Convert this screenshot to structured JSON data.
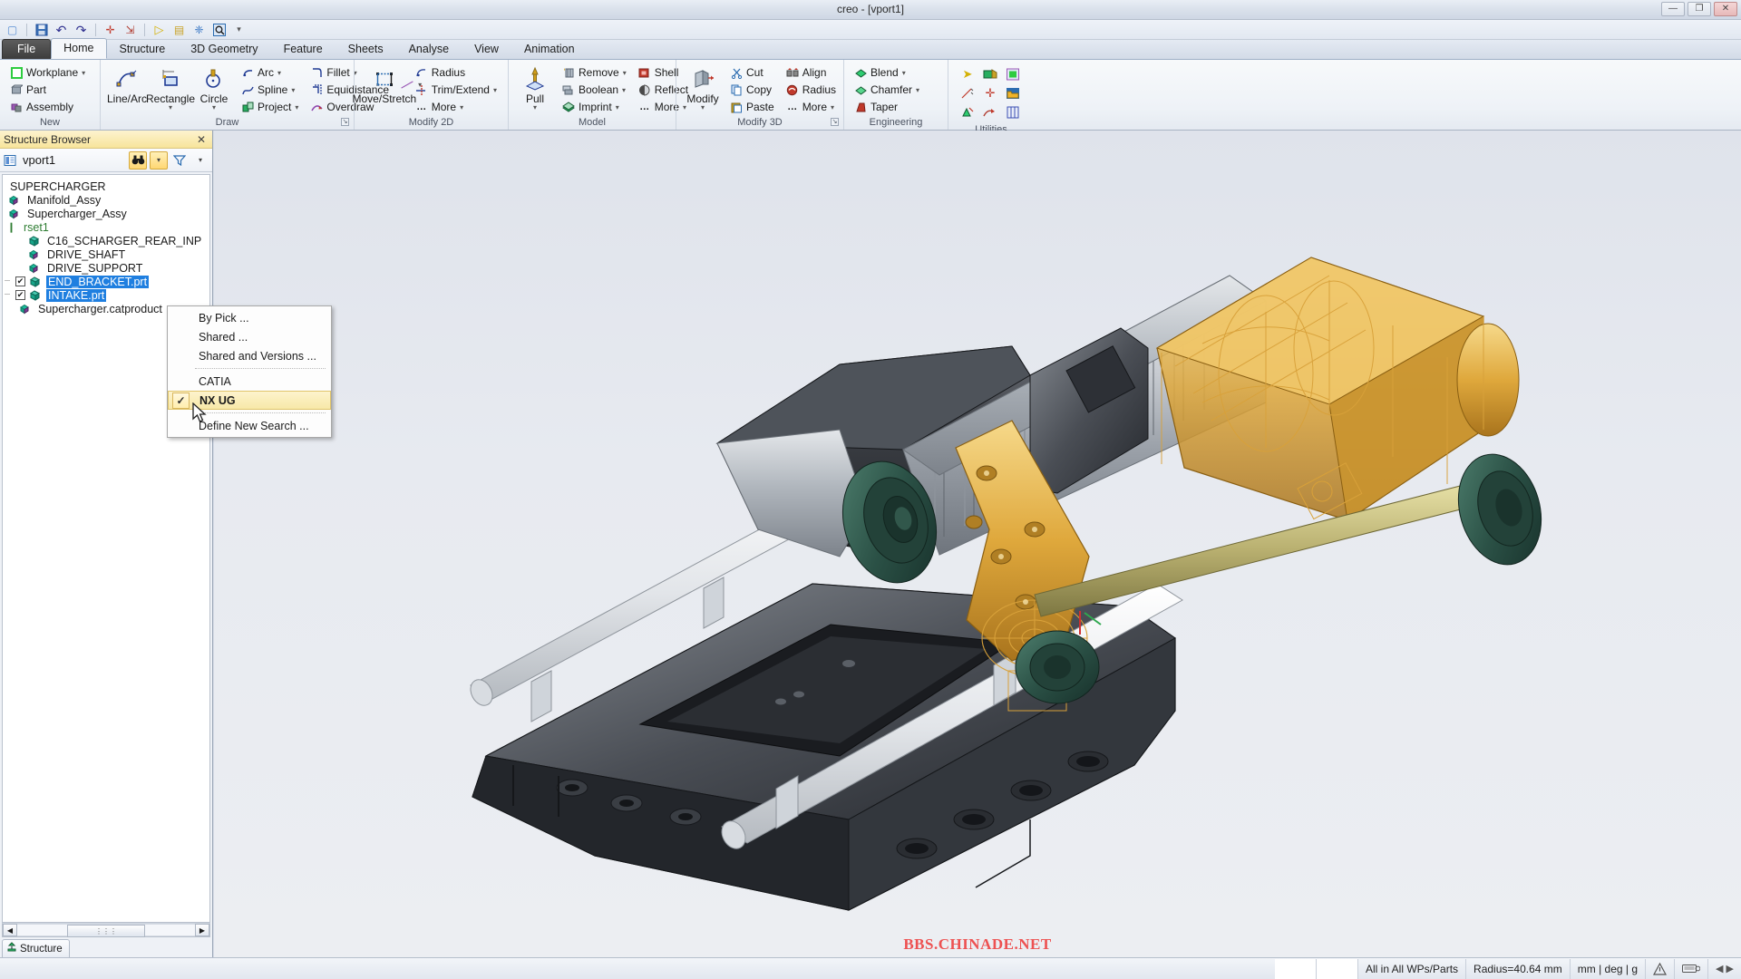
{
  "window": {
    "title": "creo - [vport1]",
    "buttons": [
      {
        "name": "minimize",
        "glyph": "—"
      },
      {
        "name": "restore",
        "glyph": "❐"
      },
      {
        "name": "close",
        "glyph": "✕"
      }
    ]
  },
  "quick_access": {
    "items": [
      {
        "name": "new-document-icon",
        "glyph": "▢",
        "color": "#5b8fd4"
      },
      {
        "name": "save-icon",
        "glyph": "💾",
        "color": "#2b5fa8"
      },
      {
        "name": "undo-icon",
        "glyph": "↶",
        "color": "#2f2f8f"
      },
      {
        "name": "redo-icon",
        "glyph": "↷",
        "color": "#2f2f8f"
      },
      {
        "name": "measure-icon",
        "glyph": "✛",
        "color": "#c0392b"
      },
      {
        "name": "export-icon",
        "glyph": "⇲",
        "color": "#b03a2e"
      },
      {
        "name": "play-icon",
        "glyph": "▷",
        "color": "#d4b106"
      },
      {
        "name": "list-play-icon",
        "glyph": "▤",
        "color": "#c9a227"
      },
      {
        "name": "snap-icon",
        "glyph": "❈",
        "color": "#3574c4"
      },
      {
        "name": "zoom-window-icon",
        "glyph": "🔍",
        "color": "#2b6cb0"
      },
      {
        "name": "customize-qat-icon",
        "glyph": "⋮",
        "color": "#555"
      }
    ]
  },
  "tabs": [
    {
      "name": "file",
      "label": "File"
    },
    {
      "name": "home",
      "label": "Home"
    },
    {
      "name": "structure",
      "label": "Structure"
    },
    {
      "name": "3d-geometry",
      "label": "3D Geometry"
    },
    {
      "name": "feature",
      "label": "Feature"
    },
    {
      "name": "sheets",
      "label": "Sheets"
    },
    {
      "name": "analyse",
      "label": "Analyse"
    },
    {
      "name": "view",
      "label": "View"
    },
    {
      "name": "animation",
      "label": "Animation"
    }
  ],
  "active_tab": "Home",
  "ribbon": {
    "groups": [
      {
        "name": "new",
        "title": "New",
        "dialog_launcher": false,
        "minis": [
          {
            "label": "Workplane",
            "icon": "workplane-icon",
            "glyph": "▢",
            "color": "#2ecc40",
            "caret": true
          },
          {
            "label": "Part",
            "icon": "part-icon",
            "glyph": "▤",
            "color": "#7f8c8d",
            "caret": false
          },
          {
            "label": "Assembly",
            "icon": "assembly-icon",
            "glyph": "▥",
            "color": "#8e44ad",
            "caret": false
          }
        ]
      },
      {
        "name": "draw",
        "title": "Draw",
        "dialog_launcher": true,
        "bigs": [
          {
            "label": "Line/Arc",
            "icon": "line-arc-icon",
            "glyph": "⌒",
            "color": "#1f3a93",
            "caret": false
          },
          {
            "label": "Rectangle",
            "icon": "rectangle-icon",
            "glyph": "▭",
            "color": "#1f3a93",
            "caret": true
          },
          {
            "label": "Circle",
            "icon": "circle-icon",
            "glyph": "◯",
            "color": "#1f3a93",
            "caret": true
          }
        ],
        "minis": [
          {
            "label": "Arc",
            "icon": "arc-icon",
            "glyph": "◟",
            "color": "#1f3a93",
            "caret": true
          },
          {
            "label": "Spline",
            "icon": "spline-icon",
            "glyph": "∿",
            "color": "#1f3a93",
            "caret": true
          },
          {
            "label": "Project",
            "icon": "project-icon",
            "glyph": "⬓",
            "color": "#27ae60",
            "caret": true
          }
        ],
        "minis2": [
          {
            "label": "Fillet",
            "icon": "fillet-icon",
            "glyph": "◝",
            "color": "#1f3a93",
            "caret": true
          },
          {
            "label": "Equidistance",
            "icon": "equidistance-icon",
            "glyph": "⌐",
            "color": "#1f3a93",
            "caret": false
          },
          {
            "label": "Overdraw",
            "icon": "overdraw-icon",
            "glyph": "✎",
            "color": "#8e44ad",
            "caret": false
          }
        ],
        "extra": [
          {
            "label": "",
            "icon": "line-style-icon",
            "glyph": "╱",
            "color": "#9b59b6",
            "caret": true
          }
        ]
      },
      {
        "name": "modify-2d",
        "title": "Modify 2D",
        "dialog_launcher": false,
        "bigs": [
          {
            "label": "Move/Stretch",
            "icon": "move-stretch-icon",
            "glyph": "⊏",
            "color": "#1f3a93",
            "caret": false
          }
        ],
        "minis": [
          {
            "label": "Radius",
            "icon": "radius-icon",
            "glyph": "◜",
            "color": "#1f3a93",
            "caret": false
          },
          {
            "label": "Trim/Extend",
            "icon": "trim-extend-icon",
            "glyph": "┤",
            "color": "#1f3a93",
            "caret": true
          },
          {
            "label": "More",
            "icon": "more-icon",
            "glyph": "…",
            "color": "#333",
            "caret": true
          }
        ]
      },
      {
        "name": "model",
        "title": "Model",
        "dialog_launcher": false,
        "bigs": [
          {
            "label": "Pull",
            "icon": "pull-icon",
            "glyph": "⇡",
            "color": "#d4a017",
            "caret": true
          }
        ],
        "minis": [
          {
            "label": "Remove",
            "icon": "remove-icon",
            "glyph": "▥",
            "color": "#7f8c8d",
            "caret": true
          },
          {
            "label": "Boolean",
            "icon": "boolean-icon",
            "glyph": "▨",
            "color": "#7f8c8d",
            "caret": true
          },
          {
            "label": "Imprint",
            "icon": "imprint-icon",
            "glyph": "▩",
            "color": "#27ae60",
            "caret": true
          }
        ],
        "minis2": [
          {
            "label": "Shell",
            "icon": "shell-icon",
            "glyph": "▣",
            "color": "#c0392b",
            "caret": false
          },
          {
            "label": "Reflect",
            "icon": "reflect-icon",
            "glyph": "◐",
            "color": "#555",
            "caret": false
          },
          {
            "label": "More",
            "icon": "more-icon",
            "glyph": "…",
            "color": "#333",
            "caret": true
          }
        ]
      },
      {
        "name": "modify-3d",
        "title": "Modify 3D",
        "dialog_launcher": true,
        "bigs": [
          {
            "label": "Modify",
            "icon": "modify-icon",
            "glyph": "▦",
            "color": "#7f8c8d",
            "caret": true
          }
        ],
        "minis": [
          {
            "label": "Cut",
            "icon": "cut-icon",
            "glyph": "✂",
            "color": "#2b6cb0",
            "caret": false
          },
          {
            "label": "Copy",
            "icon": "copy-icon",
            "glyph": "⧉",
            "color": "#2b6cb0",
            "caret": false
          },
          {
            "label": "Paste",
            "icon": "paste-icon",
            "glyph": "▤",
            "color": "#2b6cb0",
            "caret": false
          }
        ],
        "minis2": [
          {
            "label": "Align",
            "icon": "align-icon",
            "glyph": "⇹",
            "color": "#c0392b",
            "caret": false
          },
          {
            "label": "Radius",
            "icon": "radius-3d-icon",
            "glyph": "◉",
            "color": "#c0392b",
            "caret": false
          },
          {
            "label": "More",
            "icon": "more-icon",
            "glyph": "…",
            "color": "#333",
            "caret": true
          }
        ]
      },
      {
        "name": "engineering",
        "title": "Engineering",
        "dialog_launcher": false,
        "minis": [
          {
            "label": "Blend",
            "icon": "blend-icon",
            "glyph": "◆",
            "color": "#2ecc71",
            "caret": true
          },
          {
            "label": "Chamfer",
            "icon": "chamfer-icon",
            "glyph": "◆",
            "color": "#2ecc71",
            "caret": true
          },
          {
            "label": "Taper",
            "icon": "taper-icon",
            "glyph": "◪",
            "color": "#c0392b",
            "caret": false
          }
        ]
      },
      {
        "name": "utilities",
        "title": "Utilities",
        "dialog_launcher": false,
        "icons": [
          {
            "name": "select-arrow-icon",
            "glyph": "➤",
            "color": "#d4b106"
          },
          {
            "name": "render-icon",
            "glyph": "▣",
            "color": "#27ae60"
          },
          {
            "name": "display-mode-icon",
            "glyph": "▢",
            "color": "#2ecc40"
          },
          {
            "name": "dimension-icon",
            "glyph": "╱",
            "color": "#c0392b"
          },
          {
            "name": "point-cloud-icon",
            "glyph": "✛",
            "color": "#c0392b"
          },
          {
            "name": "open-folder-icon",
            "glyph": "📁",
            "color": "#d4a017"
          },
          {
            "name": "transform-icon",
            "glyph": "⟳",
            "color": "#27ae60"
          },
          {
            "name": "export-view-icon",
            "glyph": "⇲",
            "color": "#b03a2e"
          },
          {
            "name": "grid-icon",
            "glyph": "▥",
            "color": "#3b4fb3"
          }
        ]
      }
    ]
  },
  "structure_browser": {
    "title": "Structure Browser",
    "close_glyph": "✕",
    "viewport_label": "vport1",
    "viewport_icon": "viewport-icon",
    "toolbar": {
      "find_icon": "binoculars-icon",
      "find_glyph": "👓",
      "find_caret": "▾",
      "filter_icon": "filter-icon",
      "filter_glyph": "▽",
      "filter_caret": "▾"
    },
    "tree": [
      {
        "label": "SUPERCHARGER",
        "indent": 0,
        "icon": "none",
        "checkbox": null,
        "selected": false,
        "color": "#000"
      },
      {
        "label": "Manifold_Assy",
        "indent": 1,
        "icon": "assembly-icon",
        "checkbox": null,
        "selected": false,
        "color": "#000"
      },
      {
        "label": "Supercharger_Assy",
        "indent": 1,
        "icon": "assembly-icon",
        "checkbox": null,
        "selected": false,
        "color": "#000"
      },
      {
        "label": "rset1",
        "indent": 0,
        "icon": "rset-icon",
        "checkbox": null,
        "selected": false,
        "color": "#2e7d32"
      },
      {
        "label": "C16_SCHARGER_REAR_INP",
        "indent": 2,
        "icon": "part-solid-icon",
        "checkbox": null,
        "selected": false,
        "color": "#000"
      },
      {
        "label": "DRIVE_SHAFT",
        "indent": 2,
        "icon": "assembly-icon",
        "checkbox": null,
        "selected": false,
        "color": "#000"
      },
      {
        "label": "DRIVE_SUPPORT",
        "indent": 2,
        "icon": "assembly-icon",
        "checkbox": null,
        "selected": false,
        "color": "#000"
      },
      {
        "label": "END_BRACKET.prt",
        "indent": 2,
        "icon": "part-solid-icon",
        "checkbox": true,
        "selected": true,
        "color": "#000"
      },
      {
        "label": "INTAKE.prt",
        "indent": 2,
        "icon": "part-solid-icon",
        "checkbox": true,
        "selected": true,
        "color": "#000"
      },
      {
        "label": "Supercharger.catproduct",
        "indent": 1,
        "icon": "assembly-icon",
        "checkbox": null,
        "selected": false,
        "color": "#000"
      }
    ],
    "scrollbar": {
      "left_arrow": "◀",
      "right_arrow": "▶",
      "thumb_grip": "⋮⋮⋮"
    },
    "bottom_tab": {
      "label": "Structure",
      "icon": "structure-icon",
      "glyph": "⚙"
    }
  },
  "context_menu": {
    "items": [
      {
        "label": "By Pick ...",
        "checked": false,
        "highlighted": false,
        "separator_after": false
      },
      {
        "label": "Shared ...",
        "checked": false,
        "highlighted": false,
        "separator_after": false
      },
      {
        "label": "Shared and Versions ...",
        "checked": false,
        "highlighted": false,
        "separator_after": true
      },
      {
        "label": "CATIA",
        "checked": false,
        "highlighted": false,
        "separator_after": false
      },
      {
        "label": "NX UG",
        "checked": true,
        "highlighted": true,
        "separator_after": true
      },
      {
        "label": "Define New Search ...",
        "checked": false,
        "highlighted": false,
        "separator_after": false
      }
    ],
    "check_glyph": "✓"
  },
  "viewport": {
    "watermark": "BBS.CHINADE.NET",
    "model_name": "Supercharger assembly"
  },
  "status_bar": {
    "cells": [
      {
        "name": "status-scope",
        "label": "All in All WPs/Parts"
      },
      {
        "name": "status-radius",
        "label": "Radius=40.64 mm"
      },
      {
        "name": "status-units",
        "label": "mm | deg | g"
      }
    ],
    "icons": [
      {
        "name": "warning-icon",
        "glyph": "⚠"
      },
      {
        "name": "keyboard-icon",
        "glyph": "⌨"
      },
      {
        "name": "resize-grip-icon",
        "glyph": "◀▶"
      }
    ]
  },
  "colors": {
    "accent_yellow": "#f7e49b",
    "selection_blue": "#1f7fe0",
    "watermark_red": "#e44444",
    "gold_highlight": "#e8ae3c"
  }
}
